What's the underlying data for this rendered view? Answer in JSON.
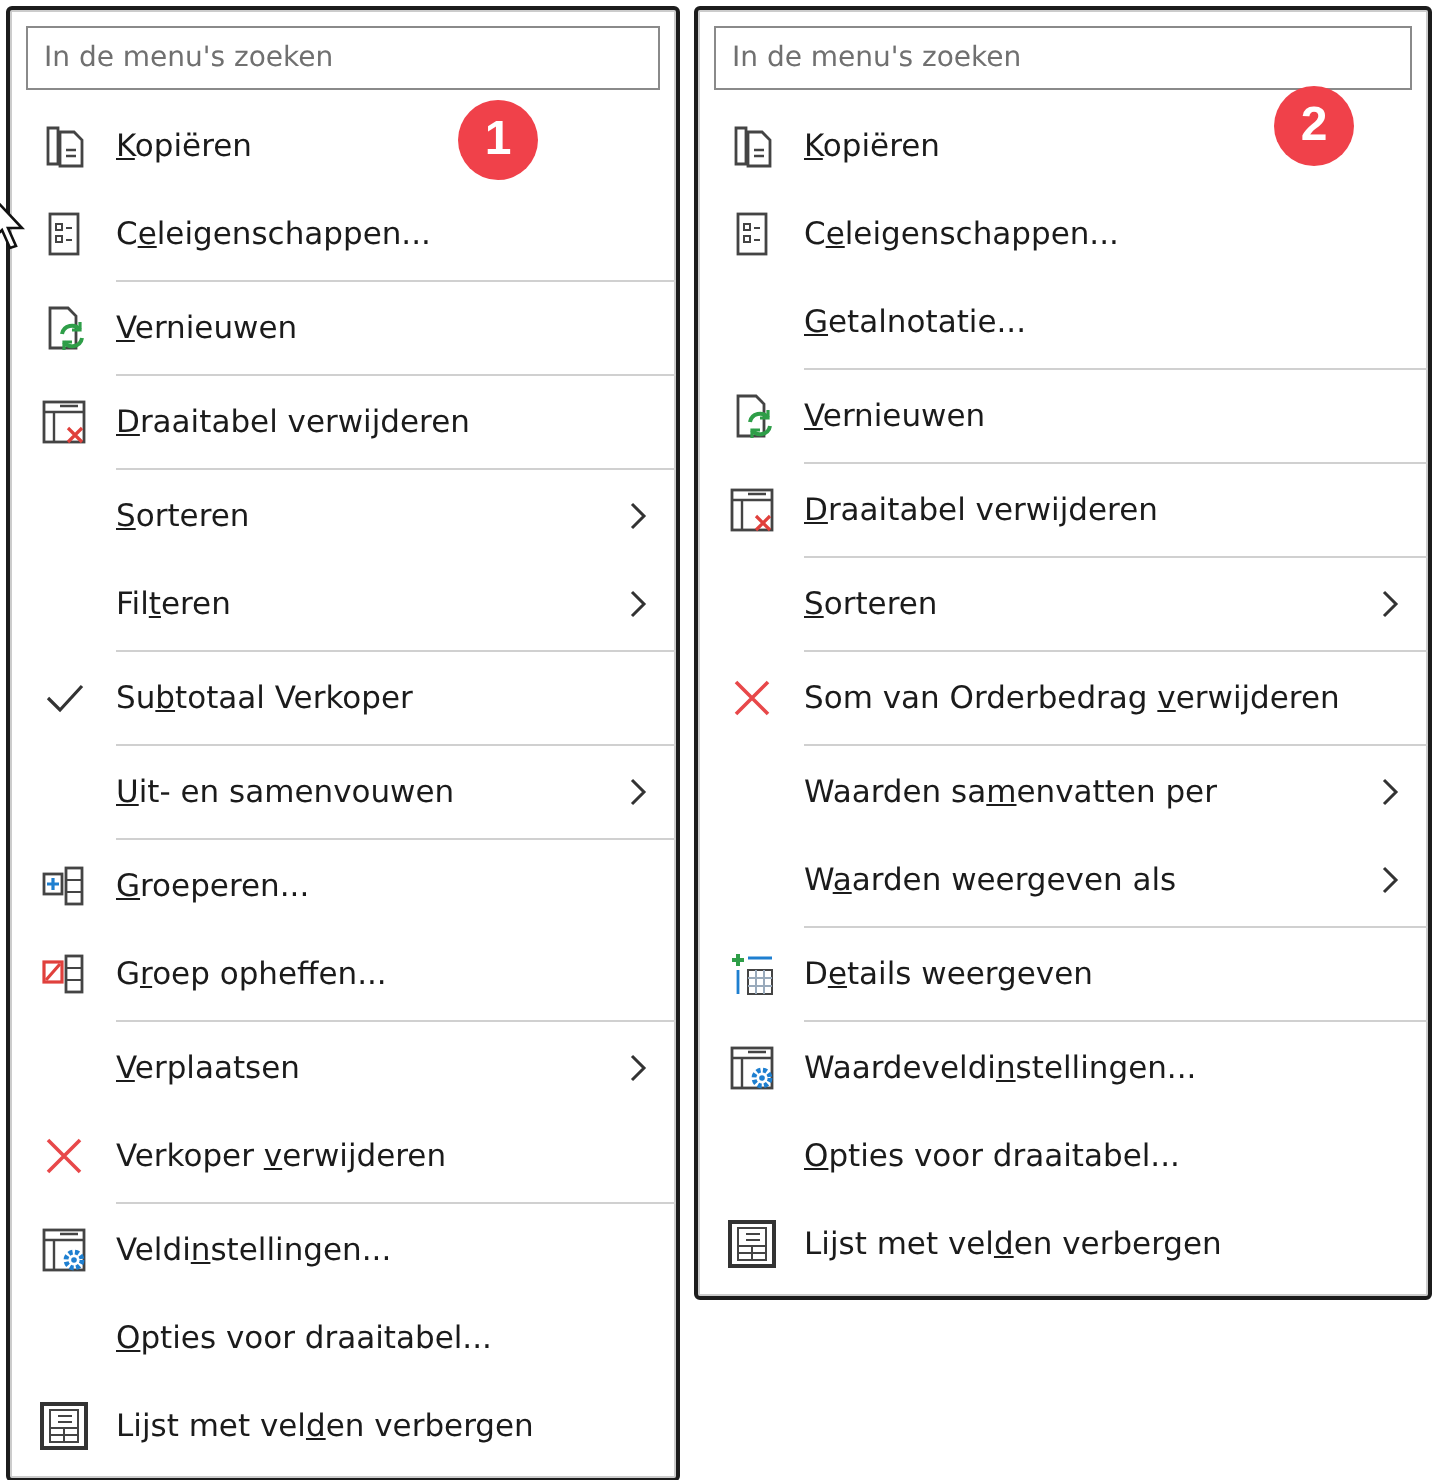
{
  "menus": [
    {
      "badge": "1",
      "pointer_visible": true,
      "search": {
        "placeholder": "In de menu's zoeken"
      },
      "items": [
        {
          "kind": "copy",
          "label": [
            {
              "text": "K",
              "underlined": true
            },
            {
              "text": "opiëren",
              "underlined": false
            }
          ],
          "checked": false,
          "submenu": false
        },
        {
          "kind": "properties",
          "label": [
            {
              "text": "C",
              "underlined": false
            },
            {
              "text": "e",
              "underlined": true
            },
            {
              "text": "leigenschappen...",
              "underlined": false
            }
          ],
          "checked": false,
          "submenu": false
        },
        {
          "kind": "separator"
        },
        {
          "kind": "refresh",
          "label": [
            {
              "text": "V",
              "underlined": true
            },
            {
              "text": "ernieuwen",
              "underlined": false
            }
          ],
          "checked": false,
          "submenu": false
        },
        {
          "kind": "separator"
        },
        {
          "kind": "table-delete",
          "label": [
            {
              "text": "D",
              "underlined": true
            },
            {
              "text": "raaitabel verwijderen",
              "underlined": false
            }
          ],
          "checked": false,
          "submenu": false
        },
        {
          "kind": "separator"
        },
        {
          "kind": "plain",
          "label": [
            {
              "text": "S",
              "underlined": true
            },
            {
              "text": "orteren",
              "underlined": false
            }
          ],
          "checked": false,
          "submenu": true
        },
        {
          "kind": "plain",
          "label": [
            {
              "text": "Fil",
              "underlined": false
            },
            {
              "text": "t",
              "underlined": true
            },
            {
              "text": "eren",
              "underlined": false
            }
          ],
          "checked": false,
          "submenu": true
        },
        {
          "kind": "separator"
        },
        {
          "kind": "plain",
          "label": [
            {
              "text": "Su",
              "underlined": false
            },
            {
              "text": "b",
              "underlined": true
            },
            {
              "text": "totaal Verkoper",
              "underlined": false
            }
          ],
          "checked": true,
          "submenu": false
        },
        {
          "kind": "separator"
        },
        {
          "kind": "plain",
          "label": [
            {
              "text": "U",
              "underlined": true
            },
            {
              "text": "it- en samenvouwen",
              "underlined": false
            }
          ],
          "checked": false,
          "submenu": true
        },
        {
          "kind": "separator"
        },
        {
          "kind": "group",
          "label": [
            {
              "text": "G",
              "underlined": true
            },
            {
              "text": "roeperen...",
              "underlined": false
            }
          ],
          "checked": false,
          "submenu": false
        },
        {
          "kind": "ungroup",
          "label": [
            {
              "text": "G",
              "underlined": false
            },
            {
              "text": "r",
              "underlined": true
            },
            {
              "text": "oep opheffen...",
              "underlined": false
            }
          ],
          "checked": false,
          "submenu": false
        },
        {
          "kind": "separator"
        },
        {
          "kind": "plain",
          "label": [
            {
              "text": "V",
              "underlined": true
            },
            {
              "text": "erplaatsen",
              "underlined": false
            }
          ],
          "checked": false,
          "submenu": true
        },
        {
          "kind": "remove",
          "label": [
            {
              "text": "Verkoper ",
              "underlined": false
            },
            {
              "text": "v",
              "underlined": true
            },
            {
              "text": "erwijderen",
              "underlined": false
            }
          ],
          "checked": false,
          "submenu": false
        },
        {
          "kind": "separator"
        },
        {
          "kind": "settings",
          "label": [
            {
              "text": "Veldi",
              "underlined": false
            },
            {
              "text": "n",
              "underlined": true
            },
            {
              "text": "stellingen...",
              "underlined": false
            }
          ],
          "checked": false,
          "submenu": false
        },
        {
          "kind": "plain",
          "label": [
            {
              "text": "O",
              "underlined": true
            },
            {
              "text": "pties voor draaitabel...",
              "underlined": false
            }
          ],
          "checked": false,
          "submenu": false
        },
        {
          "kind": "field-list",
          "label": [
            {
              "text": "Lijst met vel",
              "underlined": false
            },
            {
              "text": "d",
              "underlined": true
            },
            {
              "text": "en verbergen",
              "underlined": false
            }
          ],
          "checked": false,
          "submenu": false
        }
      ]
    },
    {
      "badge": "2",
      "pointer_visible": false,
      "search": {
        "placeholder": "In de menu's zoeken"
      },
      "items": [
        {
          "kind": "copy",
          "label": [
            {
              "text": "K",
              "underlined": true
            },
            {
              "text": "opiëren",
              "underlined": false
            }
          ],
          "checked": false,
          "submenu": false
        },
        {
          "kind": "properties",
          "label": [
            {
              "text": "C",
              "underlined": false
            },
            {
              "text": "e",
              "underlined": true
            },
            {
              "text": "leigenschappen...",
              "underlined": false
            }
          ],
          "checked": false,
          "submenu": false
        },
        {
          "kind": "plain",
          "label": [
            {
              "text": "G",
              "underlined": true
            },
            {
              "text": "etalnotatie...",
              "underlined": false
            }
          ],
          "checked": false,
          "submenu": false
        },
        {
          "kind": "separator"
        },
        {
          "kind": "refresh",
          "label": [
            {
              "text": "V",
              "underlined": true
            },
            {
              "text": "ernieuwen",
              "underlined": false
            }
          ],
          "checked": false,
          "submenu": false
        },
        {
          "kind": "separator"
        },
        {
          "kind": "table-delete",
          "label": [
            {
              "text": "D",
              "underlined": true
            },
            {
              "text": "raaitabel verwijderen",
              "underlined": false
            }
          ],
          "checked": false,
          "submenu": false
        },
        {
          "kind": "separator"
        },
        {
          "kind": "plain",
          "label": [
            {
              "text": "S",
              "underlined": true
            },
            {
              "text": "orteren",
              "underlined": false
            }
          ],
          "checked": false,
          "submenu": true
        },
        {
          "kind": "separator"
        },
        {
          "kind": "remove",
          "label": [
            {
              "text": "Som van Orderbedrag ",
              "underlined": false
            },
            {
              "text": "v",
              "underlined": true
            },
            {
              "text": "erwijderen",
              "underlined": false
            }
          ],
          "checked": false,
          "submenu": false
        },
        {
          "kind": "separator"
        },
        {
          "kind": "plain",
          "label": [
            {
              "text": "Waarden sa",
              "underlined": false
            },
            {
              "text": "m",
              "underlined": true
            },
            {
              "text": "envatten per",
              "underlined": false
            }
          ],
          "checked": false,
          "submenu": true
        },
        {
          "kind": "plain",
          "label": [
            {
              "text": "W",
              "underlined": false
            },
            {
              "text": "a",
              "underlined": true
            },
            {
              "text": "arden weergeven als",
              "underlined": false
            }
          ],
          "checked": false,
          "submenu": true
        },
        {
          "kind": "separator"
        },
        {
          "kind": "details",
          "label": [
            {
              "text": "D",
              "underlined": false
            },
            {
              "text": "e",
              "underlined": true
            },
            {
              "text": "tails weergeven",
              "underlined": false
            }
          ],
          "checked": false,
          "submenu": false
        },
        {
          "kind": "separator"
        },
        {
          "kind": "settings",
          "label": [
            {
              "text": "Waardeveldi",
              "underlined": false
            },
            {
              "text": "n",
              "underlined": true
            },
            {
              "text": "stellingen...",
              "underlined": false
            }
          ],
          "checked": false,
          "submenu": false
        },
        {
          "kind": "plain",
          "label": [
            {
              "text": "O",
              "underlined": true
            },
            {
              "text": "pties voor draaitabel...",
              "underlined": false
            }
          ],
          "checked": false,
          "submenu": false
        },
        {
          "kind": "field-list",
          "label": [
            {
              "text": "Lijst met vel",
              "underlined": false
            },
            {
              "text": "d",
              "underlined": true
            },
            {
              "text": "en verbergen",
              "underlined": false
            }
          ],
          "checked": false,
          "submenu": false
        }
      ]
    }
  ]
}
